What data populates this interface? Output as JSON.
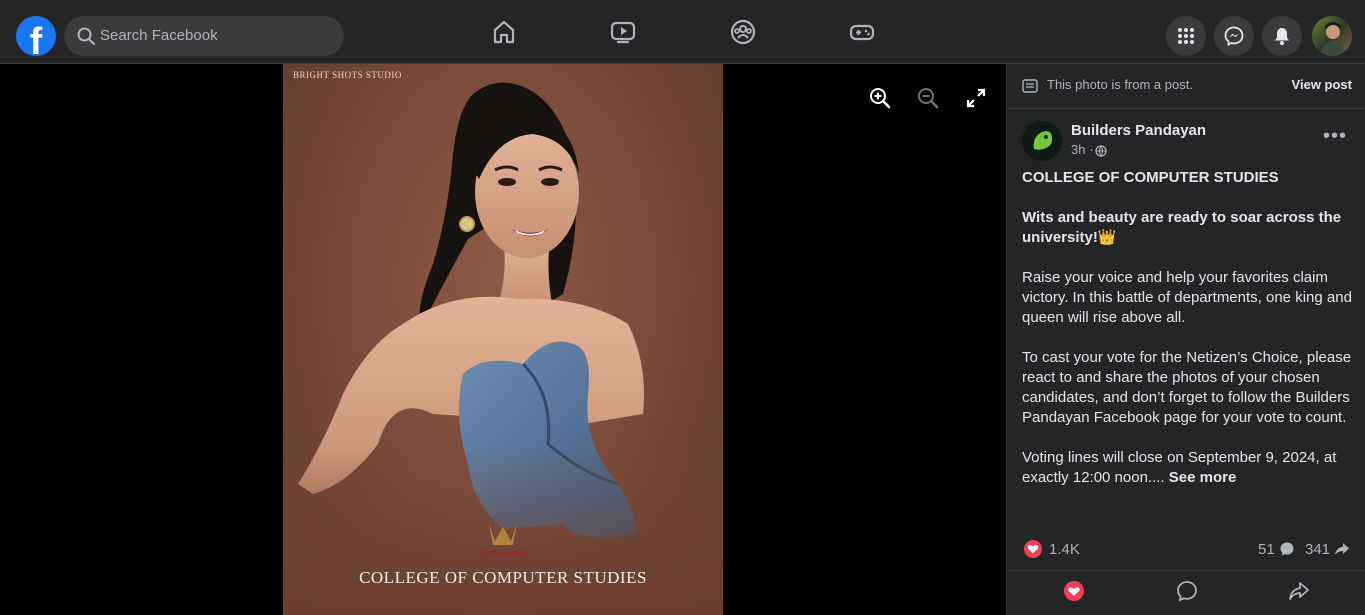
{
  "header": {
    "logo_letter": "f",
    "search_placeholder": "Search Facebook",
    "nav_icons": [
      "home-icon",
      "video-icon",
      "groups-icon",
      "gaming-icon"
    ],
    "right_icons": [
      "menu-grid-icon",
      "messenger-icon",
      "notifications-icon"
    ]
  },
  "photo": {
    "studio_mark": "BRIGHT SHOTS STUDIO",
    "caption": "COLLEGE OF COMPUTER STUDIES",
    "logo_text": "University",
    "tools": [
      "zoom-in-icon",
      "zoom-out-icon",
      "fullscreen-icon"
    ]
  },
  "panel": {
    "from_post": "This photo is from a post.",
    "view_post": "View post",
    "page_name": "Builders Pandayan",
    "time": "3h ·",
    "paragraphs": [
      "COLLEGE OF COMPUTER STUDIES",
      "Wits and beauty are ready to soar across the university!👑",
      "Raise your voice and help your favorites claim victory. In this battle of departments, one king and queen will rise above all.",
      "To cast your vote for the Netizen’s Choice, please react to and share the photos of your chosen candidates, and don’t forget to follow the Builders Pandayan Facebook page for your vote to count.",
      "Voting lines will close on September 9, 2024, at exactly 12:00 noon...."
    ],
    "see_more": "See more",
    "reactions": "1.4K",
    "comments": "51",
    "shares": "341"
  },
  "colors": {
    "accent": "#1877f2",
    "love": "#f33e58",
    "panel_bg": "#242526"
  }
}
